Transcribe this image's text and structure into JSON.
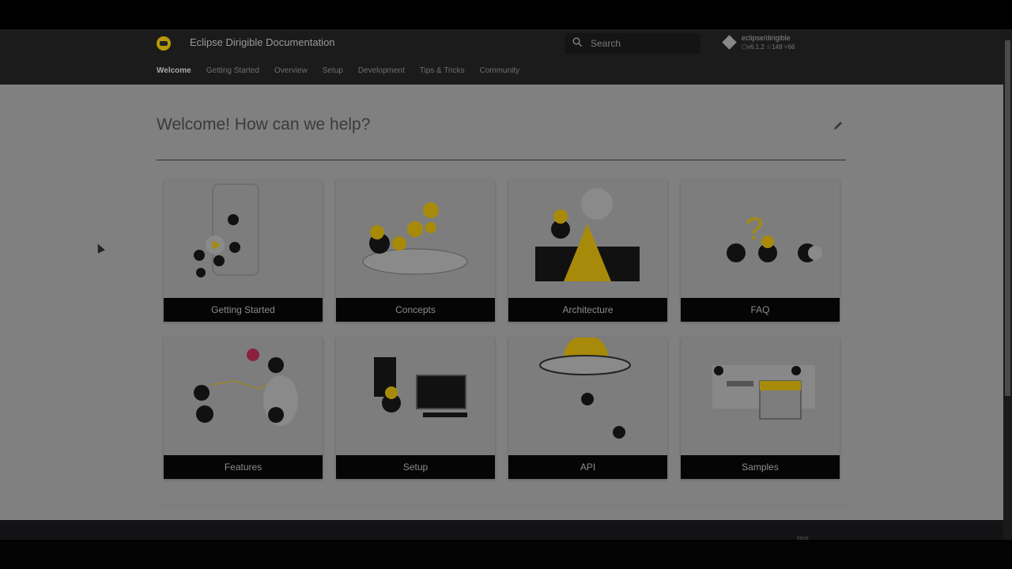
{
  "header": {
    "title": "Eclipse Dirigible Documentation",
    "search_placeholder": "Search",
    "repo": {
      "name": "eclipse/dirigible",
      "version": "v6.1.2",
      "stars": "148",
      "forks": "66"
    }
  },
  "nav": [
    {
      "label": "Welcome",
      "active": true
    },
    {
      "label": "Getting Started"
    },
    {
      "label": "Overview"
    },
    {
      "label": "Setup"
    },
    {
      "label": "Development"
    },
    {
      "label": "Tips & Tricks"
    },
    {
      "label": "Community"
    }
  ],
  "main": {
    "heading": "Welcome! How can we help?",
    "cards": [
      {
        "label": "Getting Started"
      },
      {
        "label": "Concepts"
      },
      {
        "label": "Architecture"
      },
      {
        "label": "FAQ"
      },
      {
        "label": "Features"
      },
      {
        "label": "Setup"
      },
      {
        "label": "API"
      },
      {
        "label": "Samples"
      }
    ]
  },
  "footer": {
    "next": "Next"
  },
  "colors": {
    "accent": "#b8980a",
    "header": "#1b1b1b"
  }
}
